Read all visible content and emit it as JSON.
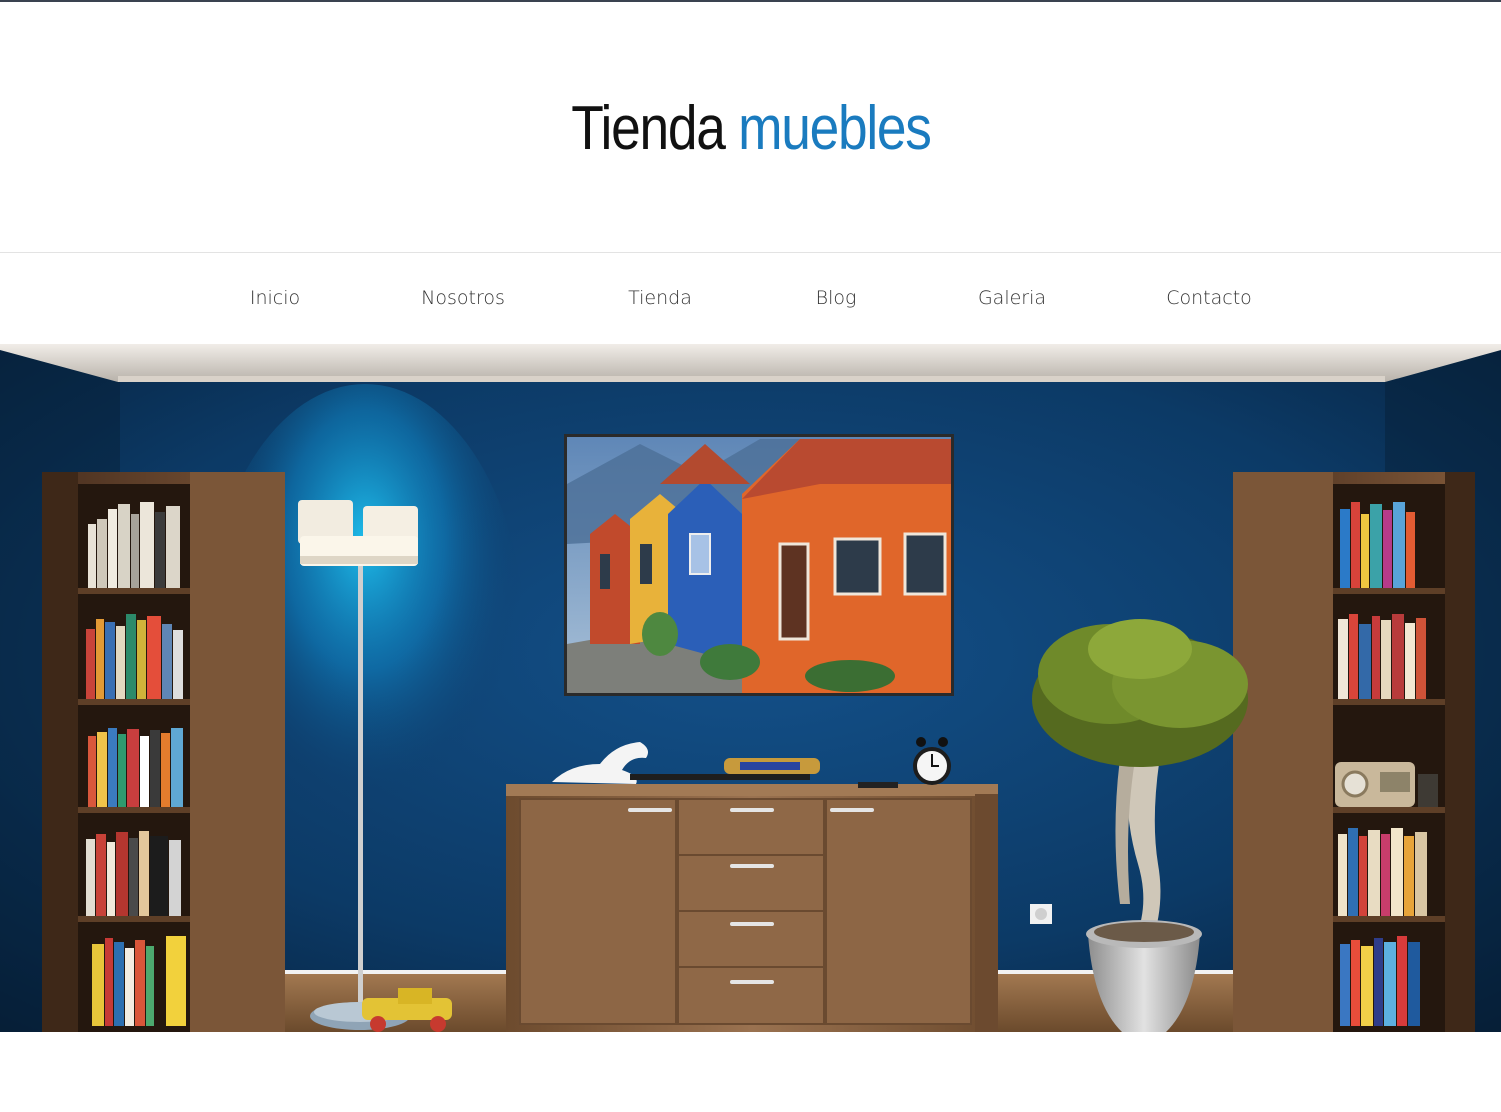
{
  "header": {
    "title_part1": "Tienda",
    "title_part2": "muebles",
    "accent_color": "#1a7bbf"
  },
  "nav": {
    "items": [
      {
        "label": "Inicio"
      },
      {
        "label": "Nosotros"
      },
      {
        "label": "Tienda"
      },
      {
        "label": "Blog"
      },
      {
        "label": "Galeria"
      },
      {
        "label": "Contacto"
      }
    ]
  },
  "hero": {
    "scene": "living-room-interior",
    "wall_color": "#0d3a63",
    "wood_color": "#8a6440"
  }
}
